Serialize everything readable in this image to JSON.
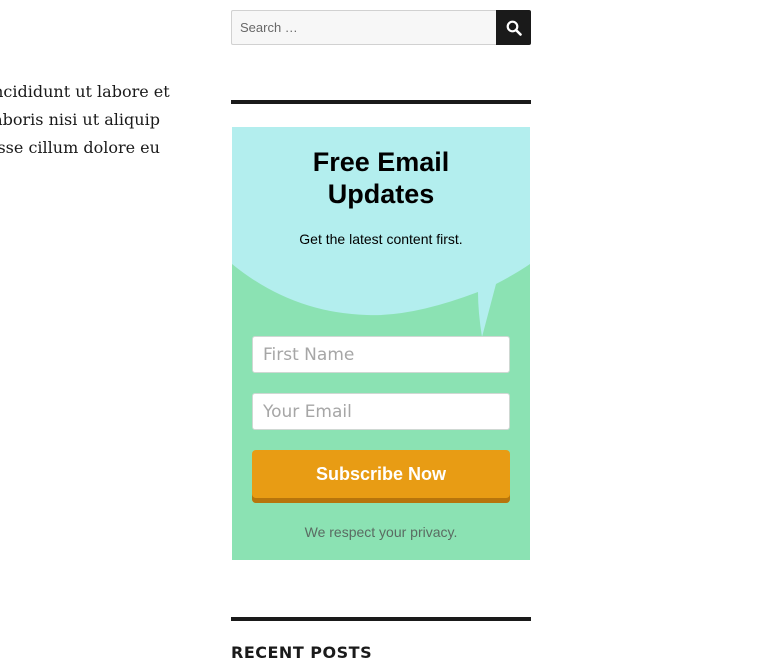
{
  "excerpt": {
    "lines": [
      "incididunt ut labore et",
      "laboris nisi ut aliquip",
      "esse cillum dolore eu"
    ]
  },
  "search": {
    "placeholder": "Search …",
    "button_icon": "search-icon"
  },
  "email_widget": {
    "title": "Free Email\nUpdates",
    "subtitle": "Get the latest content first.",
    "first_name_placeholder": "First Name",
    "email_placeholder": "Your Email",
    "subscribe_label": "Subscribe Now",
    "privacy_text": "We respect your privacy.",
    "colors": {
      "bubble": "#b3eeee",
      "background": "#8be2b3",
      "button": "#e89c14"
    }
  },
  "recent_posts": {
    "heading": "RECENT POSTS"
  }
}
